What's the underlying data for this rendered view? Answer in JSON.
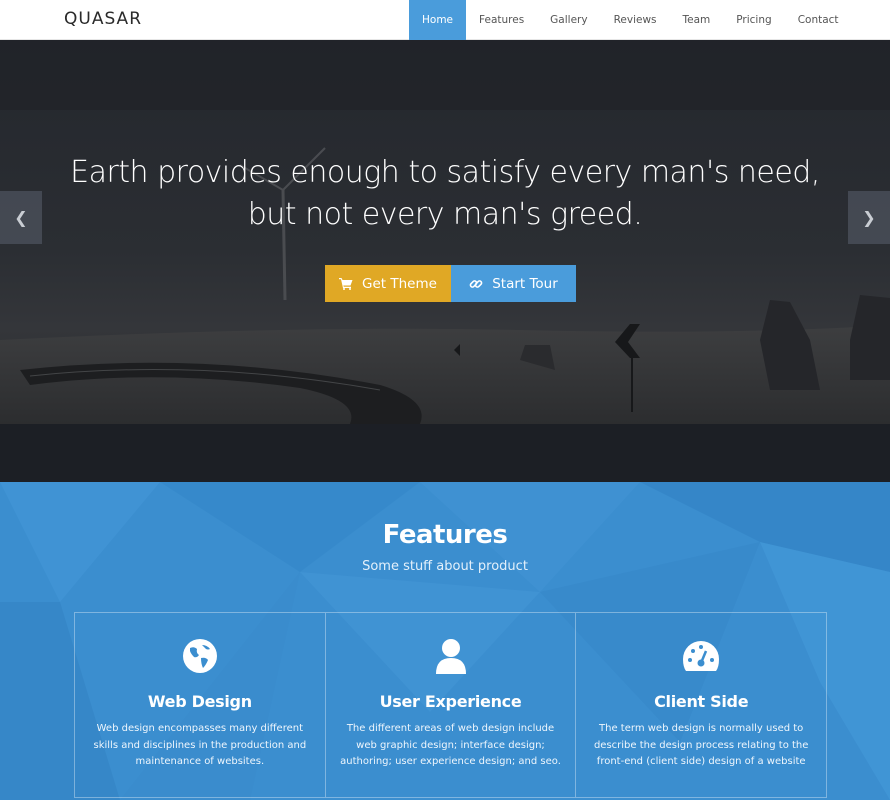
{
  "brand": "QUASAR",
  "nav": {
    "items": [
      {
        "label": "Home",
        "active": true
      },
      {
        "label": "Features"
      },
      {
        "label": "Gallery"
      },
      {
        "label": "Reviews"
      },
      {
        "label": "Team"
      },
      {
        "label": "Pricing"
      },
      {
        "label": "Contact"
      }
    ]
  },
  "hero": {
    "line1": "Earth provides enough to satisfy every man's need,",
    "line2": "but not every man's greed.",
    "primary_button": {
      "label": "Get Theme",
      "icon": "shopping-cart-icon"
    },
    "secondary_button": {
      "label": "Start Tour",
      "icon": "link-icon"
    },
    "prev_icon": "chevron-left-icon",
    "next_icon": "chevron-right-icon"
  },
  "features": {
    "title": "Features",
    "subtitle": "Some stuff about product",
    "cards": [
      {
        "icon": "globe-icon",
        "title": "Web Design",
        "text": "Web design encompasses many different skills and disciplines in the production and maintenance of websites."
      },
      {
        "icon": "user-icon",
        "title": "User Experience",
        "text": "The different areas of web design include web graphic design; interface design; authoring; user experience design; and seo."
      },
      {
        "icon": "dashboard-icon",
        "title": "Client Side",
        "text": "The term web design is normally used to describe the design process relating to the front-end (client side) design of a website"
      }
    ]
  },
  "colors": {
    "accent": "#4a9cdb",
    "theme_button": "#e0a825",
    "features_bg": "#3b8ecf",
    "hero_bg": "#1c1f25"
  }
}
